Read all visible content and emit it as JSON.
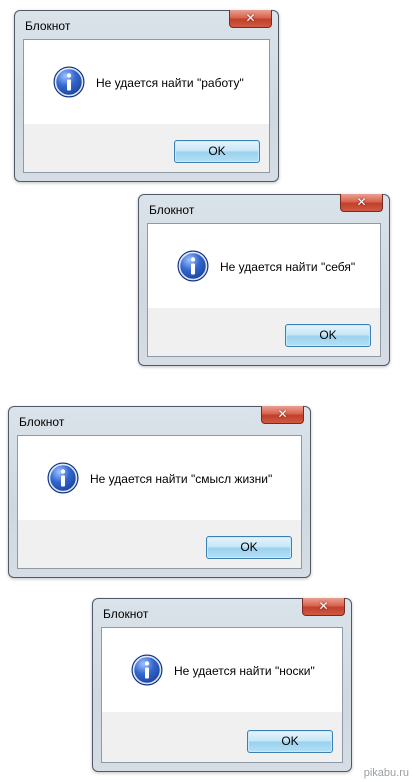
{
  "dialogs": [
    {
      "title": "Блокнот",
      "close_symbol": "✕",
      "message": "Не удается найти \"работу\"",
      "ok_label": "OK",
      "icon": "info-icon"
    },
    {
      "title": "Блокнот",
      "close_symbol": "✕",
      "message": "Не удается найти \"себя\"",
      "ok_label": "OK",
      "icon": "info-icon"
    },
    {
      "title": "Блокнот",
      "close_symbol": "✕",
      "message": "Не удается найти \"смысл жизни\"",
      "ok_label": "OK",
      "icon": "info-icon"
    },
    {
      "title": "Блокнот",
      "close_symbol": "✕",
      "message": "Не удается найти \"носки\"",
      "ok_label": "OK",
      "icon": "info-icon"
    }
  ],
  "watermark": "pikabu.ru",
  "colors": {
    "titlebar": "#d3dce4",
    "close_button": "#c9503a",
    "ok_button": "#bfe3f6",
    "button_area": "#f0f0f0",
    "info_icon": "#1f4fa8"
  }
}
